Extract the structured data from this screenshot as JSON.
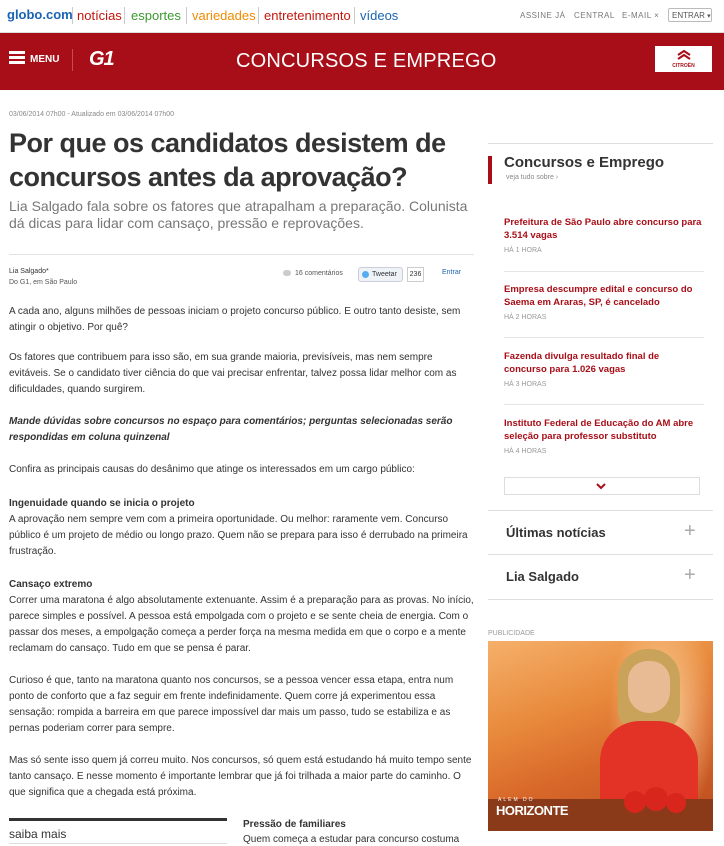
{
  "topbar": {
    "logo": "globo.com",
    "nav": [
      {
        "label": "notícias",
        "color": "#c4170c"
      },
      {
        "label": "esportes",
        "color": "#3b9a2f"
      },
      {
        "label": "variedades",
        "color": "#f08a00"
      },
      {
        "label": "entretenimento",
        "color": "#c4170c"
      },
      {
        "label": "vídeos",
        "color": "#1a63b3"
      }
    ],
    "util": {
      "assine": "ASSINE JÁ",
      "central": "CENTRAL",
      "email": "E-MAIL",
      "enter": "ENTRAR"
    }
  },
  "header": {
    "menu_label": "MENU",
    "brand": "G1",
    "section_title": "CONCURSOS E EMPREGO",
    "sponsor_label": "CITROËN",
    "accent": "#a80e17"
  },
  "article": {
    "timestamp": "03/06/2014 07h00 - Atualizado em 03/06/2014 07h00",
    "headline": "Por que os candidatos desistem de concursos antes da aprovação?",
    "subhead": "Lia Salgado fala sobre os fatores que atrapalham a preparação. Colunista dá dicas para lidar com cansaço, pressão e reprovações.",
    "author": "Lia Salgado*",
    "author_loc": "Do G1, em São Paulo",
    "comments": "16 comentários",
    "tweet_label": "Tweetar",
    "tweet_count": "236",
    "enter_link": "Entrar",
    "paragraphs": [
      "A cada ano, alguns milhões de pessoas iniciam o projeto concurso público. E outro tanto desiste, sem atingir o objetivo. Por quê?",
      "Os fatores que contribuem para isso são, em sua grande maioria, previsíveis, mas nem sempre evitáveis. Se o candidato tiver ciência do que vai precisar enfrentar, talvez possa lidar melhor com as dificuldades, quando surgirem.",
      "Mande dúvidas sobre concursos no espaço para comentários; perguntas selecionadas serão respondidas em coluna quinzenal",
      "Confira as principais causas do desânimo que atinge os interessados em um cargo público:",
      "Ingenuidade quando se inicia o projeto",
      "A aprovação nem sempre vem com a primeira oportunidade. Ou melhor: raramente vem. Concurso público é um projeto de médio ou longo prazo. Quem não se prepara para isso é derrubado na primeira frustração.",
      "Cansaço extremo",
      "Correr uma maratona é algo absolutamente extenuante. Assim é a preparação para as provas. No início, parece simples e possível. A pessoa está empolgada com o projeto e se sente cheia de energia. Com o passar dos meses, a empolgação começa a perder força na mesma medida em que o corpo e a mente reclamam do cansaço. Tudo em que se pensa é parar.",
      "Curioso é que, tanto na maratona quanto nos concursos, se a pessoa vencer essa etapa, entra num ponto de conforto que a faz seguir em frente indefinidamente. Quem corre já experimentou essa sensação: rompida a barreira em que parece impossível dar mais um passo, tudo se estabiliza e as pernas poderiam correr para sempre.",
      "Mas só sente isso quem já correu muito. Nos concursos, só quem está estudando há muito tempo sente tanto cansaço. E nesse momento é importante lembrar que já foi trilhada a maior parte do caminho. O que significa que a chegada está próxima."
    ],
    "saiba_mais": "saiba mais",
    "pressao_title": "Pressão de familiares",
    "pressao_body": "Quem começa a estudar para concurso costuma"
  },
  "sidebar": {
    "title": "Concursos e Emprego",
    "see_all": "veja tudo sobre ›",
    "items": [
      {
        "title": "Prefeitura de São Paulo abre concurso para 3.514 vagas",
        "time": "HÁ 1 HORA"
      },
      {
        "title": "Empresa descumpre edital e concurso do Saema em Araras, SP, é cancelado",
        "time": "HÁ 2 HORAS"
      },
      {
        "title": "Fazenda divulga resultado final de concurso para 1.026 vagas",
        "time": "HÁ 3 HORAS"
      },
      {
        "title": "Instituto Federal de Educação do AM abre seleção para professor substituto",
        "time": "HÁ 4 HORAS"
      }
    ],
    "accordions": [
      {
        "label": "Últimas notícias"
      },
      {
        "label": "Lia Salgado"
      }
    ]
  },
  "ad": {
    "publicidade": "PUBLICIDADE",
    "logo_small": "ALEM DO",
    "logo": "HORIZONTE"
  }
}
